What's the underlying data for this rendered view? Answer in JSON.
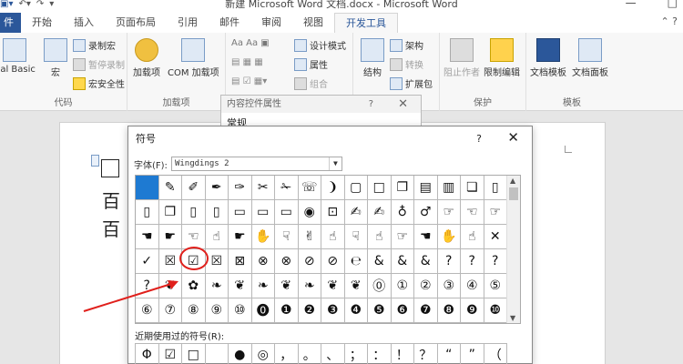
{
  "titlebar": {
    "title": "新建 Microsoft Word 文档.docx - Microsoft Word",
    "qat_icons": [
      "save-icon",
      "undo-icon",
      "redo-icon",
      "customize-icon"
    ],
    "min_glyph": "—",
    "max_glyph": "□",
    "qat_undo": "↶▾",
    "qat_redo": "↷",
    "qat_save": "▣▾",
    "qat_more": "▾"
  },
  "tabs": {
    "items": [
      {
        "label": "件",
        "key": "file"
      },
      {
        "label": "开始",
        "key": "home"
      },
      {
        "label": "插入",
        "key": "insert"
      },
      {
        "label": "页面布局",
        "key": "layout"
      },
      {
        "label": "引用",
        "key": "references"
      },
      {
        "label": "邮件",
        "key": "mailings"
      },
      {
        "label": "审阅",
        "key": "review"
      },
      {
        "label": "视图",
        "key": "view"
      },
      {
        "label": "开发工具",
        "key": "developer"
      }
    ],
    "active": "开发工具",
    "right_glyphs": "⌃  ?"
  },
  "ribbon": {
    "code": {
      "label": "代码",
      "visual_basic": "ual Basic",
      "macro": "宏",
      "record_macro": "录制宏",
      "pause_record": "暂停录制",
      "macro_security": "宏安全性"
    },
    "addins": {
      "label": "加载项",
      "addins": "加载项",
      "com_addins": "COM 加载项"
    },
    "controls": {
      "design_mode": "设计模式",
      "properties": "属性",
      "group": "组合"
    },
    "xml": {
      "structure": "结构",
      "schema": "架构",
      "transform": "转换",
      "expansion": "扩展包"
    },
    "protect": {
      "label": "保护",
      "block_authors": "阻止作者",
      "restrict_editing": "限制编辑"
    },
    "templates": {
      "label": "模板",
      "document_template": "文档模板",
      "document_panel": "文档面板"
    }
  },
  "content_control_panel": {
    "title": "内容控件属性",
    "help": "?",
    "close": "✕",
    "section": "常规"
  },
  "document": {
    "lines": [
      "百",
      "百"
    ]
  },
  "symbol_dialog": {
    "title": "符号",
    "help": "?",
    "close": "✕",
    "font_label": "字体(F):",
    "font_value": "Wingdings 2",
    "symbols": [
      "",
      "✎",
      "✐",
      "✒",
      "✑",
      "✂",
      "✁",
      "☏",
      "❩",
      "▢",
      "□",
      "❐",
      "▤",
      "▥",
      "❏",
      "▯",
      "▯",
      "❐",
      "▯",
      "▯",
      "▭",
      "▭",
      "▭",
      "◉",
      "⊡",
      "✍",
      "✍",
      "♁",
      "♂",
      "☞",
      "☜",
      "☞",
      "☚",
      "☛",
      "☜",
      "☝",
      "☛",
      "✋",
      "☟",
      "✌",
      "☝",
      "☟",
      "☝",
      "☞",
      "☚",
      "✋",
      "☝",
      "✕",
      "✓",
      "☒",
      "☑",
      "☒",
      "⊠",
      "⊗",
      "⊗",
      "⊘",
      "⊘",
      "℮",
      "&",
      "&",
      "&",
      "?",
      "?",
      "?",
      "?",
      "❦",
      "✿",
      "❧",
      "❦",
      "❧",
      "❦",
      "❧",
      "❦",
      "❦",
      "⓪",
      "①",
      "②",
      "③",
      "④",
      "⑤",
      "⑥",
      "⑦",
      "⑧",
      "⑨",
      "⑩",
      "⓿",
      "❶",
      "❷",
      "❸",
      "❹",
      "❺",
      "❻",
      "❼",
      "❽",
      "❾",
      "❿"
    ],
    "selected_index": 0,
    "recent_label": "近期使用过的符号(R):",
    "recent_symbols": [
      "Φ",
      "☑",
      "□",
      "",
      "●",
      "◎",
      "，",
      "。",
      "、",
      "；",
      "：",
      "！",
      "？",
      "“",
      "”",
      "（"
    ]
  },
  "annotation": {
    "highlight_color": "#e0201c"
  }
}
